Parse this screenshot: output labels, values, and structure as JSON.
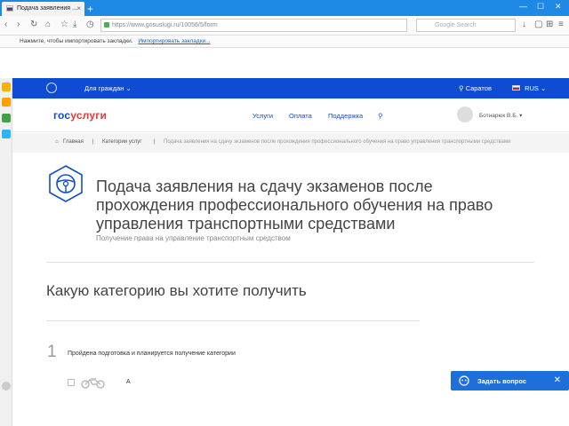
{
  "browser": {
    "tab_title": "Подача заявления ...",
    "url": "https://www.gosuslugi.ru/10056/5/form",
    "search_placeholder": "Google Search",
    "bookmarks_hint": "Нажмите, чтобы импортировать закладки.",
    "bookmarks_link": "Импортировать закладки..."
  },
  "header": {
    "for_citizens": "Для граждан",
    "city": "Саратов",
    "lang": "RUS",
    "logo_part1": "гос",
    "logo_part2": "услуги",
    "nav": [
      "Услуги",
      "Оплата",
      "Поддержка"
    ],
    "user": "Ботнарюк В.Б."
  },
  "breadcrumbs": [
    "Главная",
    "Категории услуг",
    "Подача заявления на сдачу экзаменов после прохождения профессионального обучения на право управления транспортными средствами"
  ],
  "service": {
    "title": "Подача заявления на сдачу экзаменов после прохождения профессионального обучения на право управления транспортными средствами",
    "subtitle": "Получение права на управление транспортным средством"
  },
  "form": {
    "question": "Какую категорию вы хотите получить",
    "step_number": "1",
    "step_text": "Пройдена подготовка и планируется получение категории",
    "option_label": "A"
  },
  "widget": {
    "ask_label": "Задать вопрос"
  },
  "colors": {
    "browser_blue": "#1e88e5",
    "gov_blue": "#0d4cd3",
    "logo_red": "#e53935",
    "widget_blue": "#1e6fd9"
  }
}
